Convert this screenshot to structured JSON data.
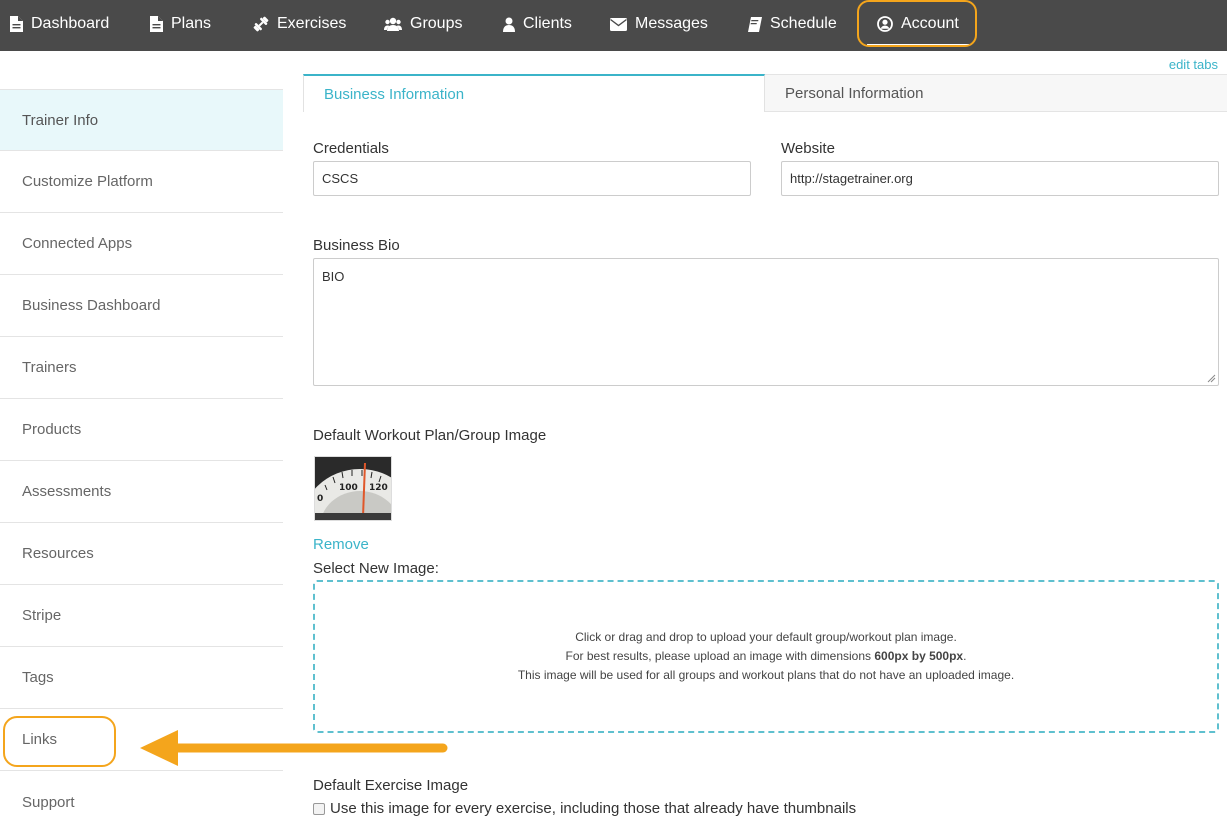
{
  "nav": {
    "items": [
      {
        "label": "Dashboard",
        "icon": "file-icon"
      },
      {
        "label": "Plans",
        "icon": "file-icon"
      },
      {
        "label": "Exercises",
        "icon": "dumbbell-icon"
      },
      {
        "label": "Groups",
        "icon": "users-icon"
      },
      {
        "label": "Clients",
        "icon": "user-icon"
      },
      {
        "label": "Messages",
        "icon": "envelope-icon"
      },
      {
        "label": "Schedule",
        "icon": "book-icon"
      },
      {
        "label": "Account",
        "icon": "user-circle-icon"
      }
    ],
    "active": "Account",
    "highlight_color": "#f4a51c",
    "background": "#4a4a4a"
  },
  "sidebar": {
    "items": [
      {
        "label": "Trainer Info",
        "active": true
      },
      {
        "label": "Customize Platform"
      },
      {
        "label": "Connected Apps"
      },
      {
        "label": "Business Dashboard"
      },
      {
        "label": "Trainers"
      },
      {
        "label": "Products"
      },
      {
        "label": "Assessments"
      },
      {
        "label": "Resources"
      },
      {
        "label": "Stripe"
      },
      {
        "label": "Tags"
      },
      {
        "label": "Links"
      },
      {
        "label": "Support"
      }
    ]
  },
  "main": {
    "edit_tabs": "edit tabs",
    "tabs": [
      {
        "label": "Business Information",
        "active": true
      },
      {
        "label": "Personal Information"
      }
    ],
    "credentials": {
      "label": "Credentials",
      "value": "CSCS"
    },
    "website": {
      "label": "Website",
      "value": "http://stagetrainer.org"
    },
    "bio": {
      "label": "Business Bio",
      "value": "BIO"
    },
    "default_image": {
      "label": "Default Workout Plan/Group Image",
      "remove": "Remove",
      "select_new": "Select New Image:",
      "drop_line1": "Click or drag and drop to upload your default group/workout plan image.",
      "drop_line2_pre": "For best results, please upload an image with dimensions ",
      "drop_line2_bold": "600px by 500px",
      "drop_line2_post": ".",
      "drop_line3": "This image will be used for all groups and workout plans that do not have an uploaded image."
    },
    "exercise_image": {
      "label": "Default Exercise Image",
      "checkbox_label": "Use this image for every exercise, including those that already have thumbnails"
    },
    "accent_color": "#3bb4c9"
  }
}
